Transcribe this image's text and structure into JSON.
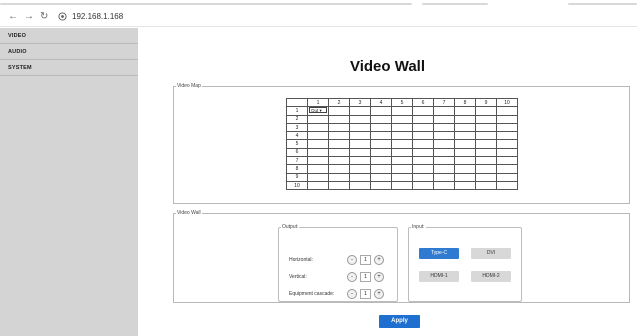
{
  "browser": {
    "url": "192.168.1.168"
  },
  "sidebar": {
    "items": [
      {
        "label": "VIDEO"
      },
      {
        "label": "AUDIO"
      },
      {
        "label": "SYSTEM"
      }
    ]
  },
  "page": {
    "title": "Video Wall",
    "apply_label": "Apply"
  },
  "video_map": {
    "legend": "Video Map",
    "columns": [
      "1",
      "2",
      "3",
      "4",
      "5",
      "6",
      "7",
      "8",
      "9",
      "10"
    ],
    "rows": [
      "1",
      "2",
      "3",
      "4",
      "5",
      "6",
      "7",
      "8",
      "9",
      "10"
    ],
    "selected_cell_value": "Out"
  },
  "video_wall": {
    "legend": "Video Wall",
    "output": {
      "label": "Output:",
      "rows": [
        {
          "label": "Horizontal:",
          "value": "1",
          "minus": "-",
          "plus": "+"
        },
        {
          "label": "Vertical:",
          "value": "1",
          "minus": "-",
          "plus": "+"
        },
        {
          "label": "Equipment cascade:",
          "value": "1",
          "minus": "-",
          "plus": "+"
        }
      ]
    },
    "input": {
      "label": "Input:",
      "buttons": [
        {
          "label": "Type-C"
        },
        {
          "label": "DVI"
        },
        {
          "label": "HDMI-1"
        },
        {
          "label": "HDMI-2"
        }
      ],
      "selected": "Type-C"
    }
  },
  "colors": {
    "accent": "#1f6fd0",
    "sidebar": "#d4d4d4"
  }
}
